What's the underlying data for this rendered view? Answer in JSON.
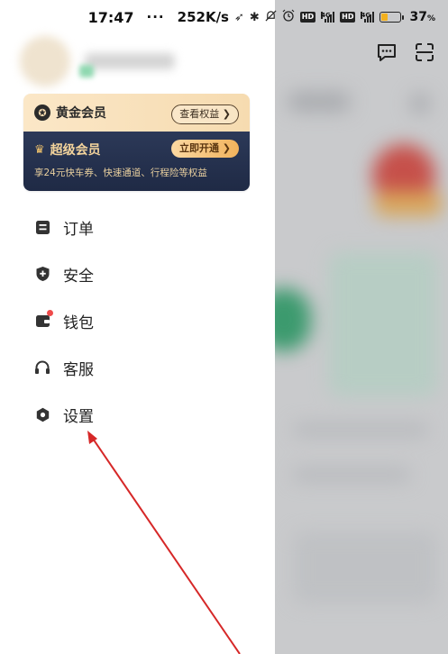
{
  "status_bar": {
    "time": "17:47",
    "dots": "···",
    "speed": "252K/s",
    "hd": "HD",
    "net": "4G",
    "battery_percent": "37",
    "battery_unit": "%",
    "battery_level": 0.37
  },
  "colors": {
    "gold_bg": "#f6dbb0",
    "super_bg": "#2c3958",
    "open_button": "#f1b25c",
    "arrow": "#d62828",
    "wallet_dot": "#ef4b4b"
  },
  "membership": {
    "gold_title": "黄金会员",
    "gold_benefits_button": "查看权益",
    "super_title": "超级会员",
    "super_open_button": "立即开通",
    "super_description": "享24元快车券、快速通道、行程险等权益"
  },
  "menu": {
    "items": [
      {
        "label": "订单",
        "icon": "order-list-icon"
      },
      {
        "label": "安全",
        "icon": "shield-icon"
      },
      {
        "label": "钱包",
        "icon": "wallet-icon"
      },
      {
        "label": "客服",
        "icon": "headset-icon"
      },
      {
        "label": "设置",
        "icon": "gear-icon"
      }
    ]
  },
  "background_app": {
    "icons": [
      "message-icon",
      "scan-icon"
    ]
  }
}
